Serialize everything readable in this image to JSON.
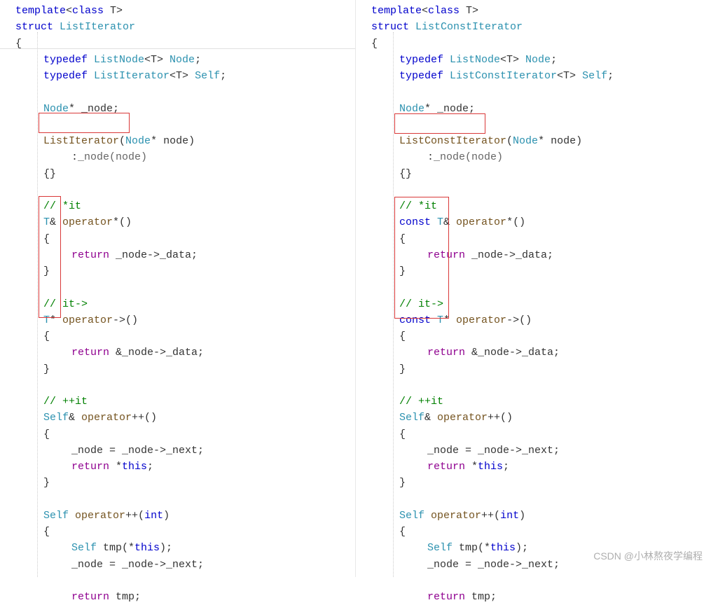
{
  "left": {
    "l1a": "template",
    "l1b": "<",
    "l1c": "class",
    "l1d": " T>",
    "l2a": "struct",
    "l2b": " ListIterator",
    "l3": "{",
    "l4a": "typedef",
    "l4b": " ListNode",
    "l4c": "<T> ",
    "l4d": "Node",
    "l4e": ";",
    "l5a": "typedef",
    "l5b": " ListIterator",
    "l5c": "<T> ",
    "l5d": "Self",
    "l5e": ";",
    "l6a": "Node",
    "l6b": "* _node;",
    "l7a": "ListIterator",
    "l7b": "(",
    "l7c": "Node",
    "l7d": "* node)",
    "l8a": ":",
    "l8b": "_node(node)",
    "l9": "{}",
    "c1": "// *it",
    "l10a": "T",
    "l10b": "& ",
    "l10c": "operator",
    "l10d": "*()",
    "l11": "{",
    "l12a": "return",
    "l12b": " _node->_data;",
    "l13": "}",
    "c2": "// it->",
    "l14a": "T",
    "l14b": "* ",
    "l14c": "operator",
    "l14d": "->()",
    "l15": "{",
    "l16a": "return",
    "l16b": " &_node->_data;",
    "l17": "}",
    "c3": "// ++it",
    "l18a": "Self",
    "l18b": "& ",
    "l18c": "operator",
    "l18d": "++()",
    "l19": "{",
    "l20a": "_node = _node->_next;",
    "l21a": "return",
    "l21b": " *",
    "l21c": "this",
    "l21d": ";",
    "l22": "}",
    "l23a": "Self",
    "l23b": " ",
    "l23c": "operator",
    "l23d": "++(",
    "l23e": "int",
    "l23f": ")",
    "l24": "{",
    "l25a": "Self",
    "l25b": " tmp(*",
    "l25c": "this",
    "l25d": ");",
    "l26": "_node = _node->_next;",
    "l27a": "return",
    "l27b": " tmp;"
  },
  "right": {
    "l1a": "template",
    "l1b": "<",
    "l1c": "class",
    "l1d": " T>",
    "l2a": "struct",
    "l2b": " ListConstIterator",
    "l3": "{",
    "l4a": "typedef",
    "l4b": " ListNode",
    "l4c": "<T> ",
    "l4d": "Node",
    "l4e": ";",
    "l5a": "typedef",
    "l5b": " ListConstIterator",
    "l5c": "<T> ",
    "l5d": "Self",
    "l5e": ";",
    "l6a": "Node",
    "l6b": "* _node;",
    "l7a": "ListConstIterator",
    "l7b": "(",
    "l7c": "Node",
    "l7d": "* node)",
    "l8a": ":",
    "l8b": "_node(node)",
    "l9": "{}",
    "c1": "// *it",
    "l10a": "const",
    "l10b": " T",
    "l10c": "& ",
    "l10d": "operator",
    "l10e": "*()",
    "l11": "{",
    "l12a": "return",
    "l12b": " _node->_data;",
    "l13": "}",
    "c2": "// it->",
    "l14a": "const",
    "l14b": " T",
    "l14c": "* ",
    "l14d": "operator",
    "l14e": "->()",
    "l15": "{",
    "l16a": "return",
    "l16b": " &_node->_data;",
    "l17": "}",
    "c3": "// ++it",
    "l18a": "Self",
    "l18b": "& ",
    "l18c": "operator",
    "l18d": "++()",
    "l19": "{",
    "l20a": "_node = _node->_next;",
    "l21a": "return",
    "l21b": " *",
    "l21c": "this",
    "l21d": ";",
    "l22": "}",
    "l23a": "Self",
    "l23b": " ",
    "l23c": "operator",
    "l23d": "++(",
    "l23e": "int",
    "l23f": ")",
    "l24": "{",
    "l25a": "Self",
    "l25b": " tmp(*",
    "l25c": "this",
    "l25d": ");",
    "l26": "_node = _node->_next;",
    "l27a": "return",
    "l27b": " tmp;"
  },
  "watermark": "CSDN @小林熬夜学编程"
}
